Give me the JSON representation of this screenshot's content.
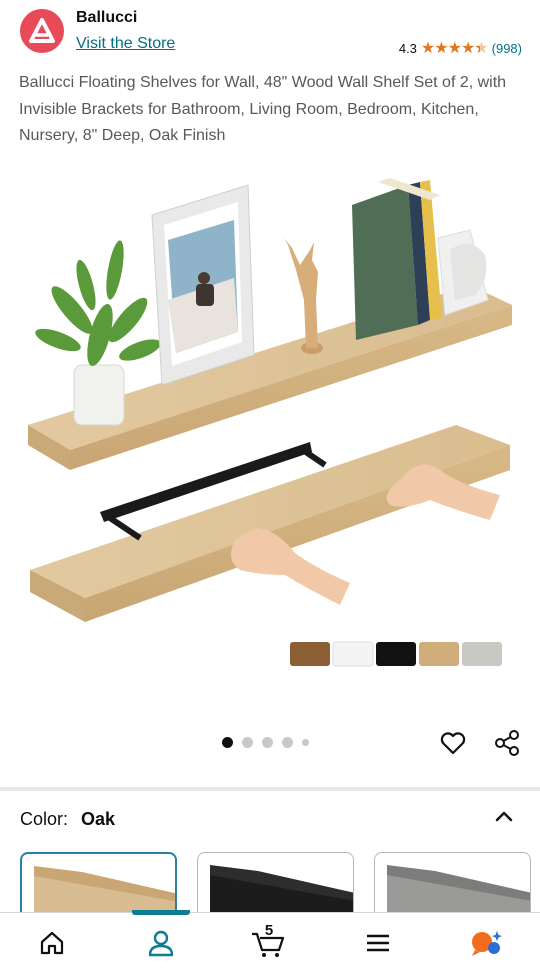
{
  "header": {
    "brand_name": "Ballucci",
    "visit_store": "Visit the Store",
    "rating_value": "4.3",
    "rating_count": "(998)",
    "rating_stars": 4.3
  },
  "product": {
    "title": "Ballucci Floating Shelves for Wall, 48\" Wood Wall Shelf Set of 2, with Invisible Brackets for Bathroom, Living Room, Bedroom, Kitchen, Nursery, 8\" Deep, Oak Finish"
  },
  "gallery": {
    "image_count": 5,
    "active_index": 0
  },
  "color_selector": {
    "label": "Color:",
    "value": "Oak",
    "options": [
      "Oak",
      "Black",
      "Gray"
    ]
  },
  "bottom_nav": {
    "items": [
      "home-icon",
      "account-icon",
      "cart-icon",
      "menu-icon",
      "assistant-icon"
    ],
    "cart_count": "5",
    "active": "account"
  },
  "colors": {
    "link": "#007185",
    "star": "#de7921",
    "accent": "#0e7c91",
    "brand": "#e84a5a"
  }
}
